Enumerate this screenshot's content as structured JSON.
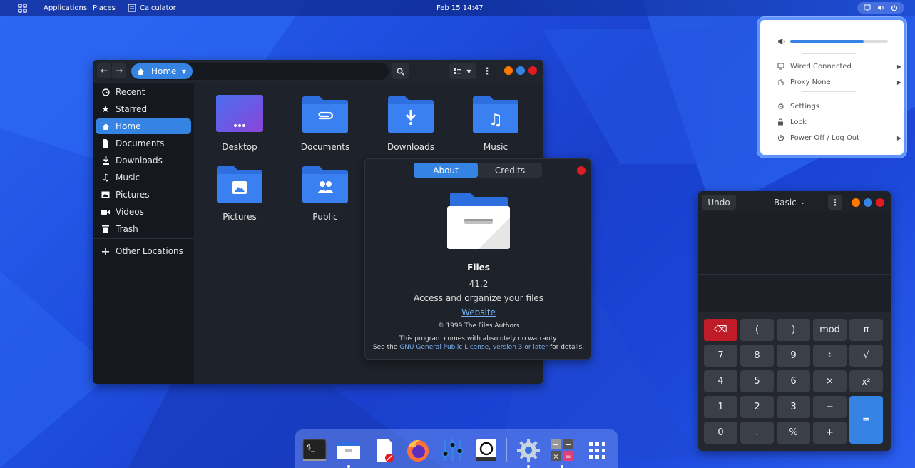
{
  "topbar": {
    "applications": "Applications",
    "places": "Places",
    "active_app": "Calculator",
    "clock": "Feb 15  14:47"
  },
  "files": {
    "location": "Home",
    "sidebar": [
      {
        "label": "Recent",
        "icon": "clock-icon"
      },
      {
        "label": "Starred",
        "icon": "star-icon"
      },
      {
        "label": "Home",
        "icon": "home-icon",
        "active": true
      },
      {
        "label": "Documents",
        "icon": "document-icon"
      },
      {
        "label": "Downloads",
        "icon": "download-icon"
      },
      {
        "label": "Music",
        "icon": "music-icon"
      },
      {
        "label": "Pictures",
        "icon": "picture-icon"
      },
      {
        "label": "Videos",
        "icon": "video-icon"
      },
      {
        "label": "Trash",
        "icon": "trash-icon"
      },
      {
        "label": "Other Locations",
        "icon": "plus-icon"
      }
    ],
    "folders": [
      {
        "label": "Desktop"
      },
      {
        "label": "Documents"
      },
      {
        "label": "Downloads"
      },
      {
        "label": "Music"
      },
      {
        "label": "Pictures"
      },
      {
        "label": "Public"
      }
    ]
  },
  "about": {
    "tab_about": "About",
    "tab_credits": "Credits",
    "app_name": "Files",
    "version": "41.2",
    "description": "Access and organize your files",
    "website": "Website",
    "copyright": "© 1999 The Files Authors",
    "warranty": "This program comes with absolutely no warranty.",
    "license_pre": "See the ",
    "license_link": "GNU General Public License, version 3 or later",
    "license_post": " for details."
  },
  "system_menu": {
    "volume": 0.75,
    "wired": "Wired Connected",
    "proxy": "Proxy None",
    "settings": "Settings",
    "lock": "Lock",
    "power": "Power Off / Log Out"
  },
  "calculator": {
    "undo": "Undo",
    "mode": "Basic",
    "rows": [
      [
        "⌫",
        "(",
        ")",
        "mod",
        "π"
      ],
      [
        "7",
        "8",
        "9",
        "÷",
        "√"
      ],
      [
        "4",
        "5",
        "6",
        "×",
        "x²"
      ],
      [
        "1",
        "2",
        "3",
        "−",
        "="
      ],
      [
        "0",
        ".",
        "%",
        "+",
        ""
      ]
    ]
  },
  "colors": {
    "accent": "#3584e4",
    "close": "#e01b24",
    "minimize": "#ff7800",
    "maximize": "#3584e4",
    "backspace": "#c01c28"
  },
  "dock": [
    {
      "name": "terminal-icon"
    },
    {
      "name": "files-icon"
    },
    {
      "name": "text-editor-icon"
    },
    {
      "name": "firefox-icon"
    },
    {
      "name": "mixer-icon"
    },
    {
      "name": "screenshot-icon"
    },
    {
      "name": "settings-icon"
    },
    {
      "name": "calculator-icon"
    },
    {
      "name": "app-grid-icon"
    }
  ]
}
